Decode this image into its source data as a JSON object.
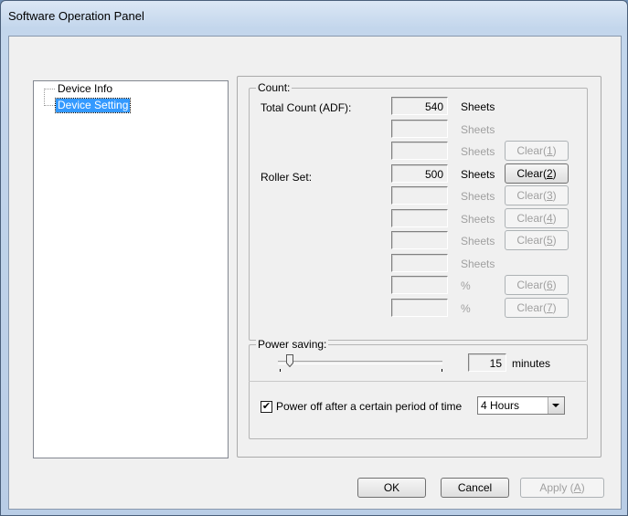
{
  "window": {
    "title": "Software Operation Panel"
  },
  "tree": {
    "items": [
      {
        "label": "Device Info",
        "selected": false
      },
      {
        "label": "Device Setting",
        "selected": true
      }
    ]
  },
  "count": {
    "title": "Count:",
    "total_label": "Total Count (ADF):",
    "roller_label": "Roller Set:",
    "rows": [
      {
        "value": "540",
        "unit": "Sheets",
        "unit_enabled": true,
        "button": "",
        "button_underline": "",
        "button_enabled": false
      },
      {
        "value": "",
        "unit": "Sheets",
        "unit_enabled": false,
        "button": "",
        "button_underline": "",
        "button_enabled": false
      },
      {
        "value": "",
        "unit": "Sheets",
        "unit_enabled": false,
        "button": "Clear(",
        "button_underline": "1",
        "button_enabled": false
      },
      {
        "value": "500",
        "unit": "Sheets",
        "unit_enabled": true,
        "button": "Clear(",
        "button_underline": "2",
        "button_enabled": true
      },
      {
        "value": "",
        "unit": "Sheets",
        "unit_enabled": false,
        "button": "Clear(",
        "button_underline": "3",
        "button_enabled": false
      },
      {
        "value": "",
        "unit": "Sheets",
        "unit_enabled": false,
        "button": "Clear(",
        "button_underline": "4",
        "button_enabled": false
      },
      {
        "value": "",
        "unit": "Sheets",
        "unit_enabled": false,
        "button": "Clear(",
        "button_underline": "5",
        "button_enabled": false
      },
      {
        "value": "",
        "unit": "Sheets",
        "unit_enabled": false,
        "button": "",
        "button_underline": "",
        "button_enabled": false
      },
      {
        "value": "",
        "unit": "%",
        "unit_enabled": false,
        "button": "Clear(",
        "button_underline": "6",
        "button_enabled": false
      },
      {
        "value": "",
        "unit": "%",
        "unit_enabled": false,
        "button": "Clear(",
        "button_underline": "7",
        "button_enabled": false
      }
    ]
  },
  "power": {
    "title": "Power saving:",
    "minutes_value": "15",
    "minutes_label": "minutes",
    "slider_fraction": 0.07,
    "poweroff_checked": true,
    "poweroff_label": "Power off after a certain period of time",
    "poweroff_selected": "4 Hours"
  },
  "buttons": {
    "ok": "OK",
    "cancel": "Cancel",
    "apply": "Apply (",
    "apply_underline": "A",
    "apply_enabled": false
  }
}
